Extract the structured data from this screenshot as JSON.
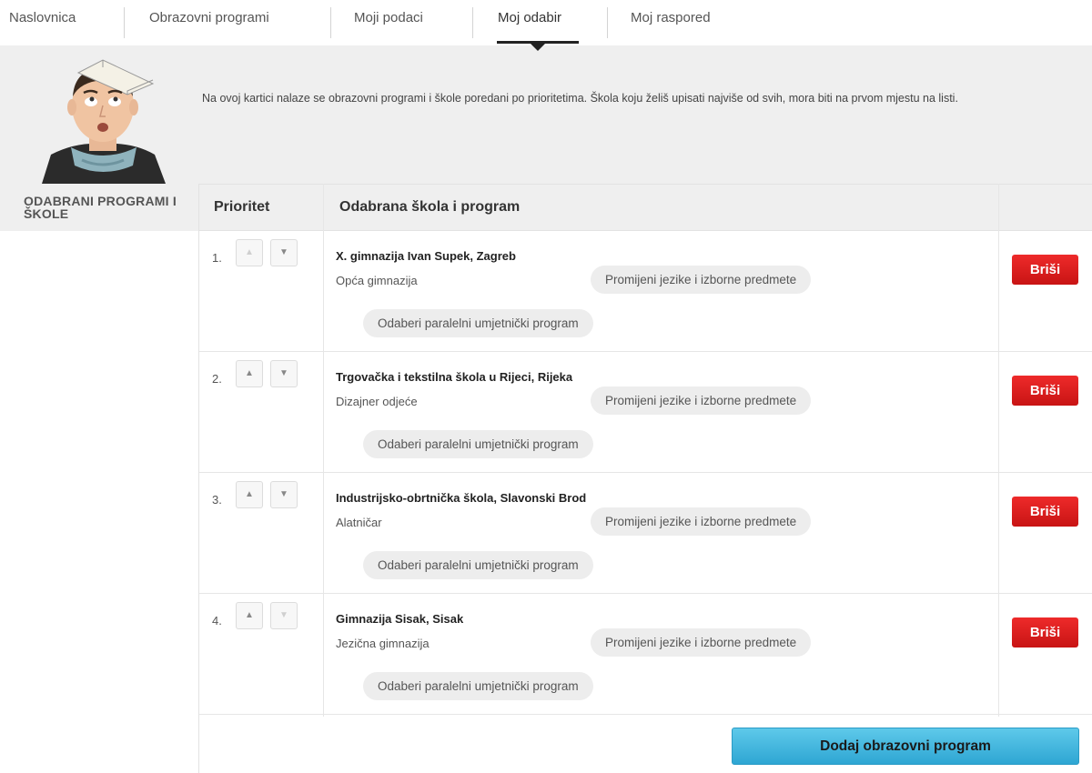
{
  "tabs": [
    {
      "label": "Naslovnica"
    },
    {
      "label": "Obrazovni programi"
    },
    {
      "label": "Moji podaci"
    },
    {
      "label": "Moj odabir",
      "active": true
    },
    {
      "label": "Moj raspored"
    }
  ],
  "banner": {
    "text": "Na ovoj kartici nalaze se obrazovni programi i škole poredani po prioritetima. Škola koju želiš upisati najviše od svih, mora biti na prvom mjestu na listi."
  },
  "section": {
    "title": "ODABRANI PROGRAMI I ŠKOLE"
  },
  "table": {
    "col_priority": "Prioritet",
    "col_school": "Odabrana škola i program",
    "rows": [
      {
        "num": "1.",
        "school": "X. gimnazija Ivan Supek, Zagreb",
        "program": "Opća gimnazija",
        "up_enabled": false,
        "down_enabled": true
      },
      {
        "num": "2.",
        "school": "Trgovačka i tekstilna škola u Rijeci, Rijeka",
        "program": "Dizajner odjeće",
        "up_enabled": true,
        "down_enabled": true
      },
      {
        "num": "3.",
        "school": "Industrijsko-obrtnička škola, Slavonski Brod",
        "program": "Alatničar",
        "up_enabled": true,
        "down_enabled": true
      },
      {
        "num": "4.",
        "school": "Gimnazija Sisak, Sisak",
        "program": "Jezična gimnazija",
        "up_enabled": true,
        "down_enabled": false
      }
    ],
    "change_languages_label": "Promijeni jezike i izborne predmete",
    "parallel_program_label": "Odaberi paralelni umjetnički program",
    "delete_label": "Briši"
  },
  "add_button_label": "Dodaj obrazovni program",
  "icons": {
    "up": "chevron-up-icon",
    "down": "chevron-down-icon"
  },
  "colors": {
    "delete": "#d91c1c",
    "add": "#3fb3de",
    "active_tab": "#222222"
  }
}
